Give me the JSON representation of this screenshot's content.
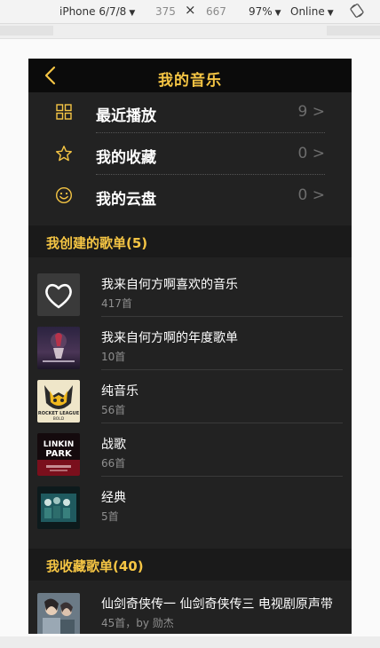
{
  "devtools": {
    "device": "iPhone 6/7/8",
    "width": "375",
    "times": "×",
    "height": "667",
    "zoom": "97%",
    "network": "Online",
    "caret": "▼"
  },
  "header": {
    "back_icon": "chevron-left-icon",
    "title": "我的音乐"
  },
  "menu": [
    {
      "label": "最近播放",
      "count": "9 >",
      "icon": "grid-icon"
    },
    {
      "label": "我的收藏",
      "count": "0 >",
      "icon": "star-icon"
    },
    {
      "label": "我的云盘",
      "count": "0 >",
      "icon": "smiley-icon"
    }
  ],
  "created_section": {
    "title": "我创建的歌单(5)",
    "playlists": [
      {
        "name": "我来自何方啊喜欢的音乐",
        "sub": "417首",
        "cover": "heart-cover"
      },
      {
        "name": "我来自何方啊的年度歌单",
        "sub": "10首",
        "cover": "album-cover-1"
      },
      {
        "name": "纯音乐",
        "sub": "56首",
        "cover": "album-cover-2"
      },
      {
        "name": "战歌",
        "sub": "66首",
        "cover": "album-cover-3"
      },
      {
        "name": "经典",
        "sub": "5首",
        "cover": "album-cover-4"
      }
    ]
  },
  "collected_section": {
    "title": "我收藏歌单(40)",
    "playlists": [
      {
        "name": "仙剑奇侠传一 仙剑奇侠传三 电视剧原声带",
        "sub": "45首，by 勋杰",
        "cover": "album-cover-5"
      }
    ]
  },
  "colors": {
    "accent": "#f5c544",
    "background": "#222222",
    "header": "#0b0b0b",
    "section": "#1a1a1a",
    "muted": "#8f8f8f"
  },
  "cover_thumbnails": {
    "album-cover-2": {
      "text_top": "ROCKET LEAGUE",
      "text_bottom": "BOLD"
    },
    "album-cover-3": {
      "text_top": "LINKIN",
      "text_bottom": "PARK"
    }
  }
}
